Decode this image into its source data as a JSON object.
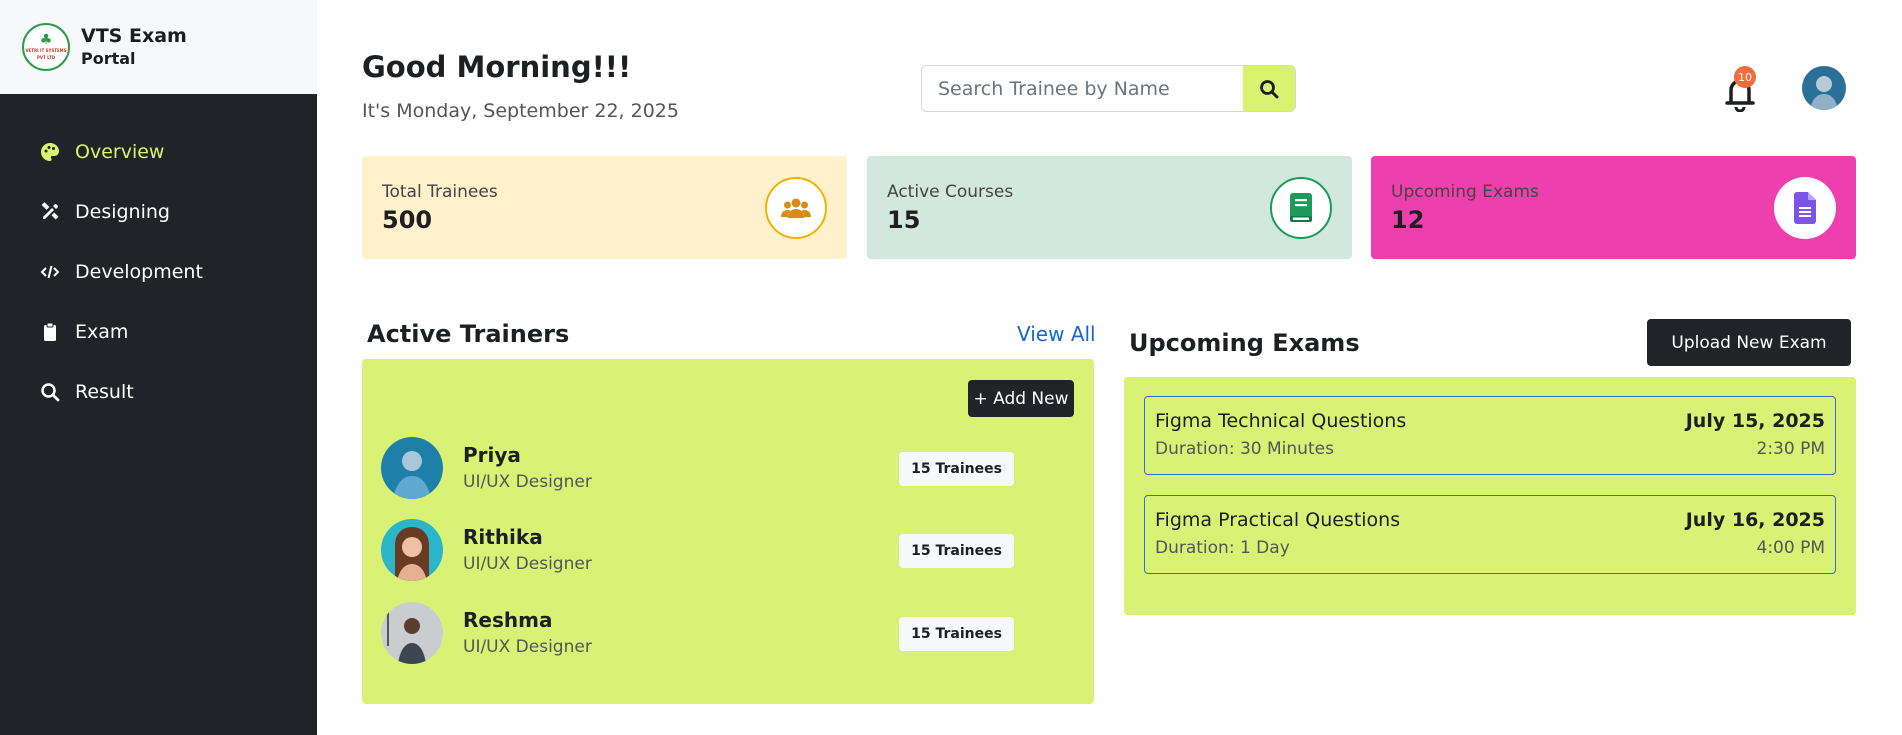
{
  "brand": {
    "title": "VTS Exam",
    "subtitle": "Portal",
    "logo_text": "VETRI IT SYSTEMS PVT LTD"
  },
  "sidebar": {
    "items": [
      {
        "label": "Overview",
        "icon": "palette-icon",
        "active": true
      },
      {
        "label": "Designing",
        "icon": "design-tools-icon",
        "active": false
      },
      {
        "label": "Development",
        "icon": "code-icon",
        "active": false
      },
      {
        "label": "Exam",
        "icon": "clipboard-icon",
        "active": false
      },
      {
        "label": "Result",
        "icon": "search-icon",
        "active": false
      }
    ]
  },
  "header": {
    "greeting": "Good Morning!!!",
    "date": "It's Monday, September 22, 2025",
    "search_placeholder": "Search Trainee by Name",
    "notification_count": "10"
  },
  "stats": [
    {
      "label": "Total Trainees",
      "value": "500",
      "bg": "#fff1cc",
      "icon": "users-icon"
    },
    {
      "label": "Active Courses",
      "value": "15",
      "bg": "#d2e8df",
      "icon": "book-icon"
    },
    {
      "label": "Upcoming Exams",
      "value": "12",
      "bg": "#ed3fad",
      "icon": "document-icon"
    }
  ],
  "trainers": {
    "title": "Active Trainers",
    "view_all": "View All",
    "add_new": "+ Add New",
    "list": [
      {
        "name": "Priya",
        "role": "UI/UX Designer",
        "trainees": "15 Trainees"
      },
      {
        "name": "Rithika",
        "role": "UI/UX Designer",
        "trainees": "15 Trainees"
      },
      {
        "name": "Reshma",
        "role": "UI/UX Designer",
        "trainees": "15 Trainees"
      }
    ]
  },
  "exams": {
    "title": "Upcoming Exams",
    "upload_label": "Upload New Exam",
    "list": [
      {
        "title": "Figma Technical Questions",
        "duration": "Duration: 30 Minutes",
        "date": "July 15, 2025",
        "time": "2:30 PM"
      },
      {
        "title": "Figma Practical Questions",
        "duration": "Duration: 1 Day",
        "date": "July 16, 2025",
        "time": "4:00 PM"
      }
    ]
  },
  "colors": {
    "accent": "#d9f276",
    "sidebar": "#202328",
    "active_nav": "#d9f26f",
    "link": "#1565d8"
  }
}
